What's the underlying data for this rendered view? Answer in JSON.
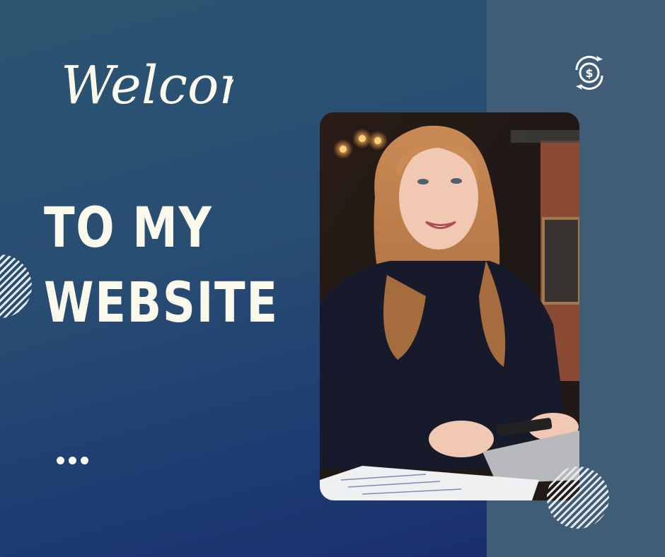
{
  "welcome_text": "Welcome",
  "headline": {
    "line1": "TO MY",
    "line2": "WEBSITE"
  },
  "colors": {
    "background_left_top": "#2c5571",
    "background_left_bottom": "#1a2f6e",
    "background_right": "#3f5d77",
    "text_cream": "#fbf8ec"
  },
  "icons": {
    "money": "money-exchange-icon",
    "dots": "more-dots-icon"
  }
}
